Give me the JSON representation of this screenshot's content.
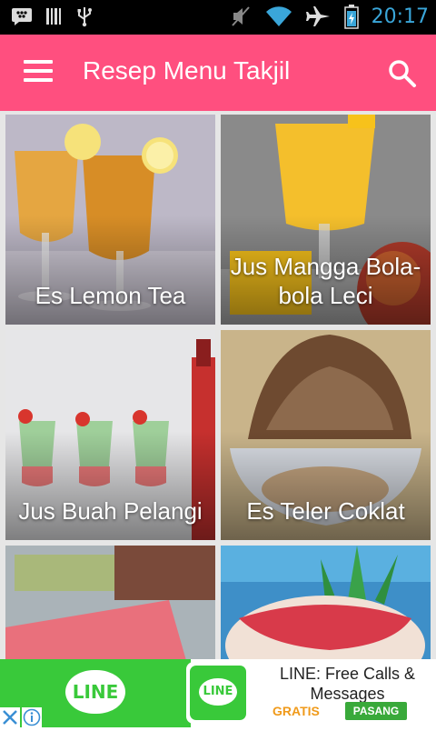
{
  "status_bar": {
    "time": "20:17",
    "icons": [
      "bbm-icon",
      "barcode-icon",
      "usb-icon",
      "mute-icon",
      "wifi-icon",
      "airplane-icon",
      "battery-icon"
    ]
  },
  "app_bar": {
    "title": "Resep Menu Takjil",
    "menu_icon": "hamburger-menu-icon",
    "search_icon": "search-icon",
    "color": "#ff4f7f"
  },
  "recipes": [
    {
      "title": "Es Lemon Tea"
    },
    {
      "title": "Jus Mangga Bola-bola Leci"
    },
    {
      "title": "Jus Buah Pelangi"
    },
    {
      "title": "Es Teler Coklat"
    },
    {
      "title": ""
    },
    {
      "title": ""
    }
  ],
  "ad": {
    "logo_text": "LINE",
    "icon_text": "LINE",
    "title": "LINE: Free Calls & Messages",
    "price": "GRATIS",
    "cta": "PASANG",
    "close_icon": "close-icon",
    "info_icon": "info-icon"
  }
}
